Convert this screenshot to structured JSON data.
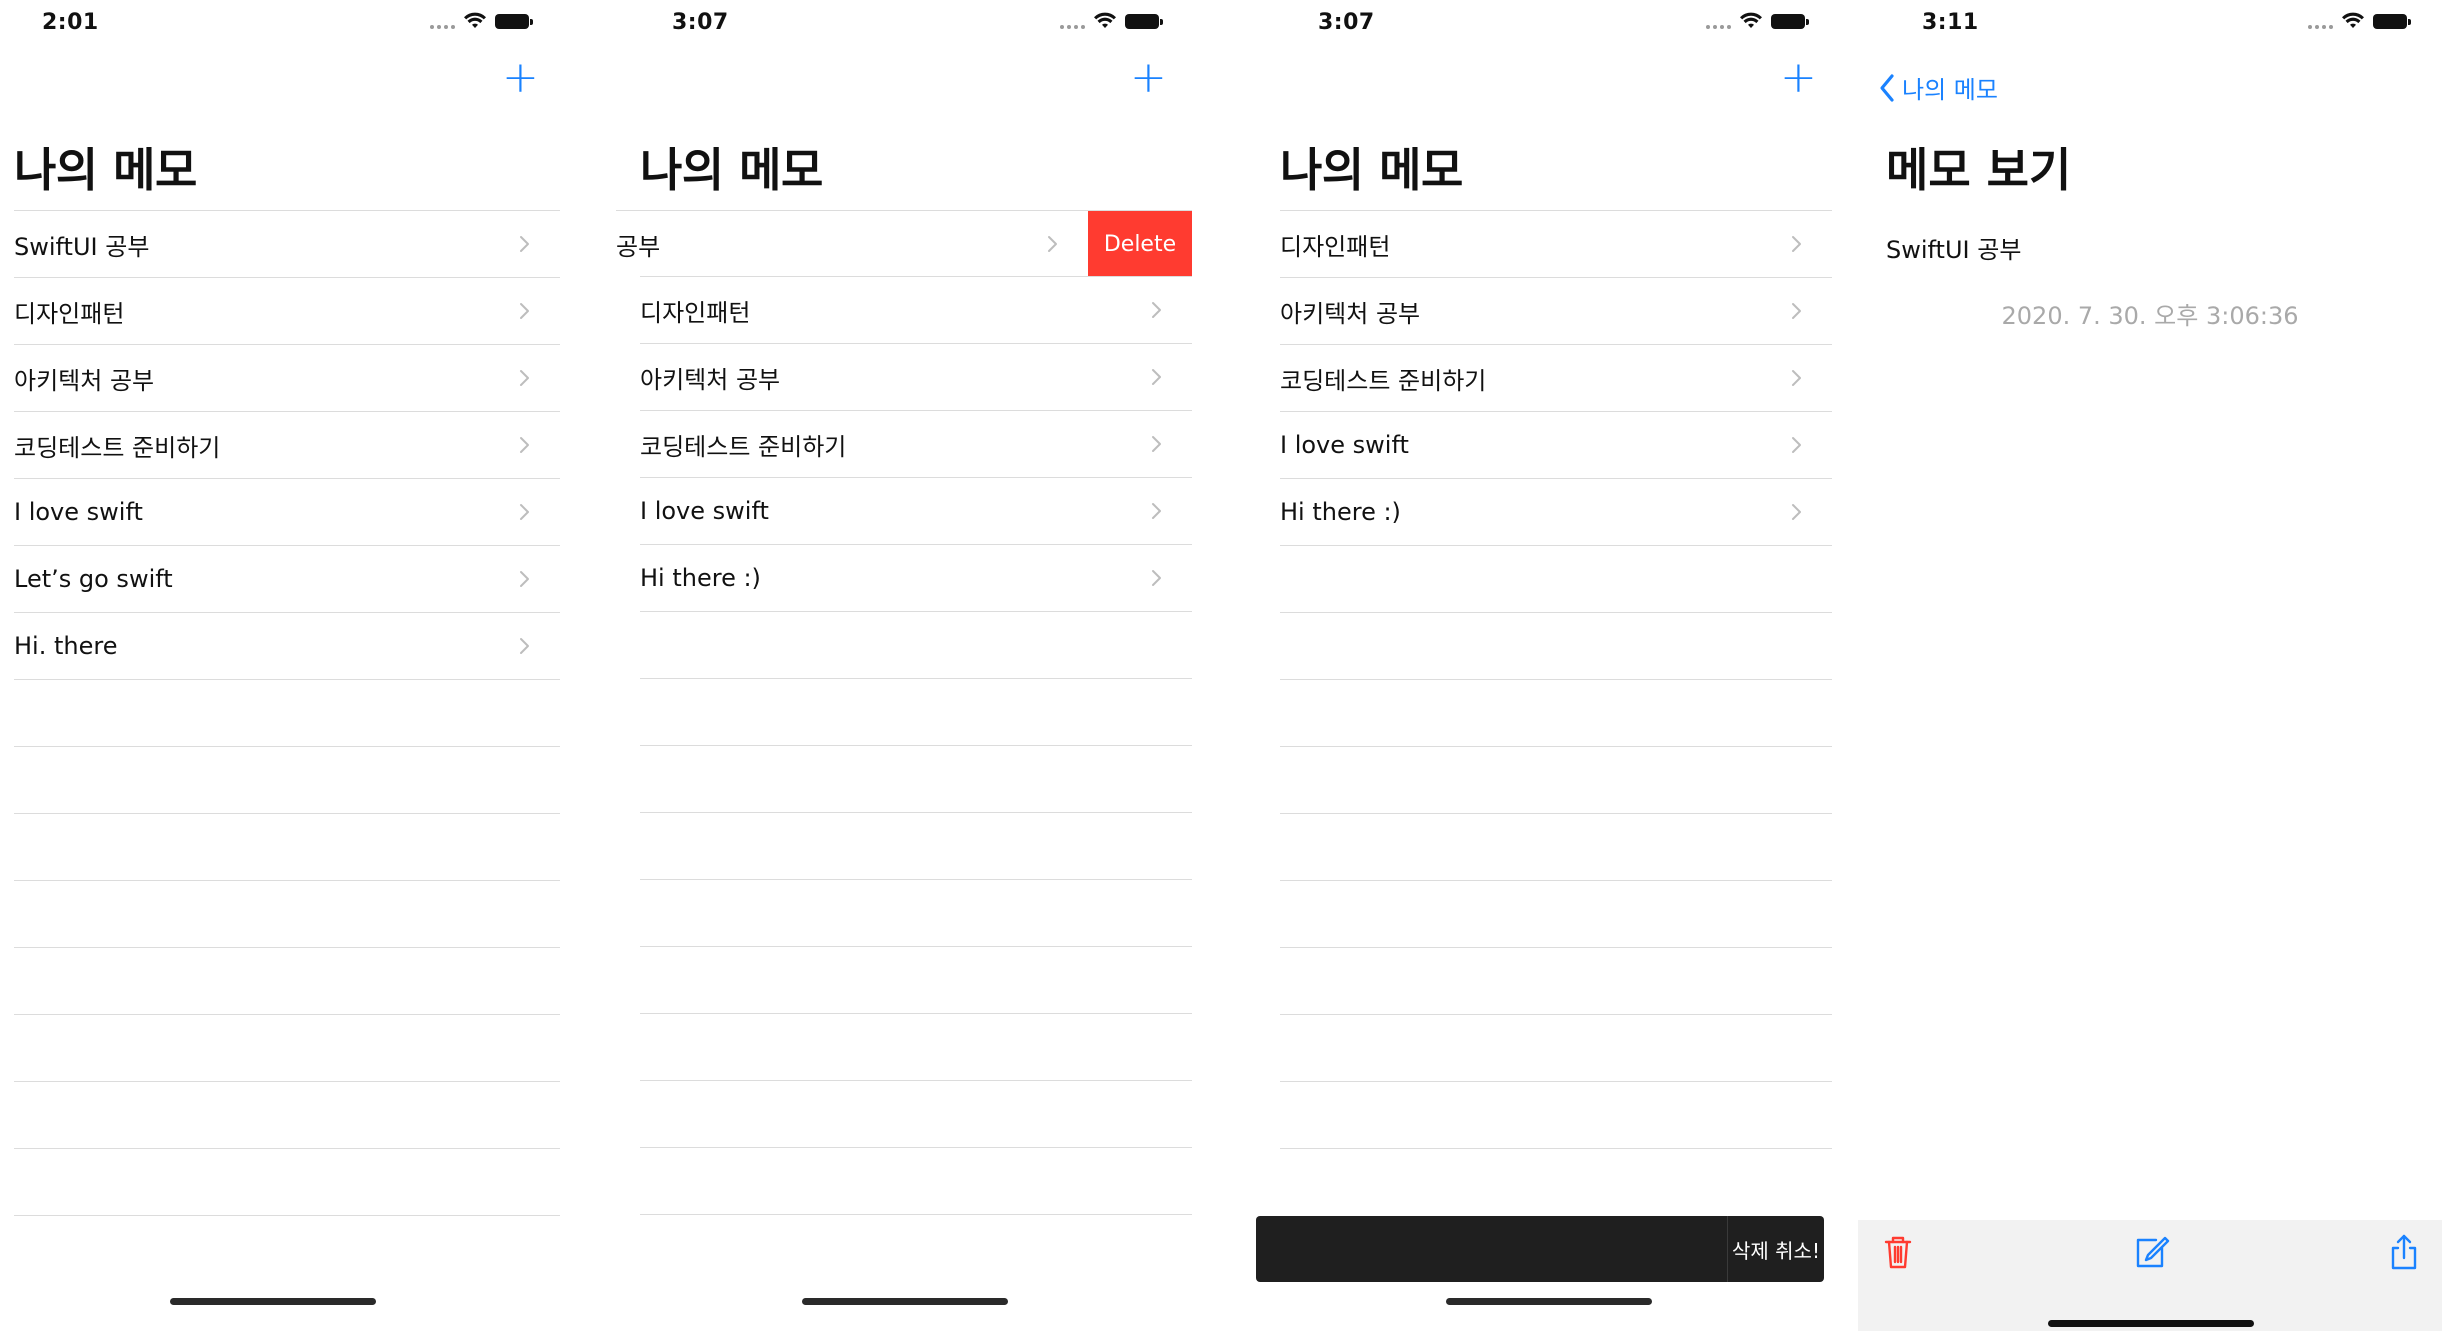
{
  "colors": {
    "accent": "#1a82ff",
    "delete": "#ff3b30",
    "snackbar_bg": "#1f1f1f",
    "date_text": "#a9a9a9"
  },
  "screen1": {
    "time": "2:01",
    "add_icon": "plus-icon",
    "title": "나의 메모",
    "rows": [
      "SwiftUI 공부",
      "디자인패턴",
      "아키텍처 공부",
      "코딩테스트 준비하기",
      "I love swift",
      "Let’s go swift",
      "Hi. there"
    ]
  },
  "screen2": {
    "time": "3:07",
    "add_icon": "plus-icon",
    "title": "나의 메모",
    "swiped_row": "공부",
    "delete_label": "Delete",
    "rows": [
      "디자인패턴",
      "아키텍처 공부",
      "코딩테스트 준비하기",
      "I love swift",
      "Hi there :)"
    ]
  },
  "screen3": {
    "time": "3:07",
    "add_icon": "plus-icon",
    "title": "나의 메모",
    "rows": [
      "디자인패턴",
      "아키텍처 공부",
      "코딩테스트 준비하기",
      "I love swift",
      "Hi there :)"
    ],
    "snackbar_action": "삭제 취소!"
  },
  "screen4": {
    "time": "3:11",
    "back_label": "나의 메모",
    "title": "메모 보기",
    "content": "SwiftUI 공부",
    "date": "2020. 7. 30. 오후 3:06:36",
    "toolbar_icons": [
      "trash-icon",
      "compose-icon",
      "share-icon"
    ]
  }
}
